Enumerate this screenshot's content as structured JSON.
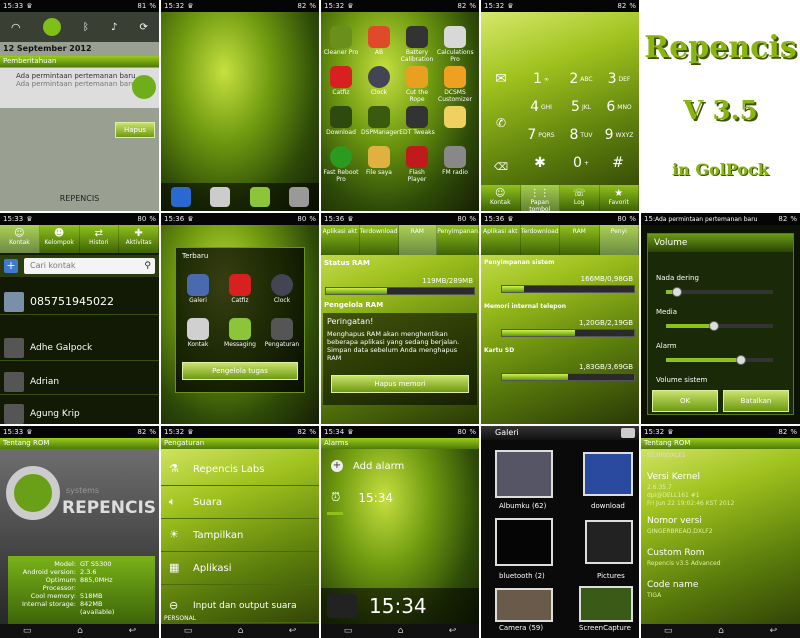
{
  "status": {
    "c1": "15:33",
    "c2": "15:32",
    "c3": "15:32",
    "c4": "15:32",
    "c6": "15:33",
    "c7": "15:36",
    "c8": "15:36",
    "c9": "15:36",
    "c10": "15:32",
    "c11": "15:33",
    "c12": "15:32",
    "c13": "15:34",
    "c14": "",
    "c15": "15:32",
    "batt_a": "81",
    "batt_b": "82",
    "batt_c": "80"
  },
  "notif": {
    "date": "12 September 2012",
    "header": "Pemberitahuan",
    "title": "Ada permintaan pertemanan baru",
    "sub": "Ada permintaan pertemanan baru",
    "button": "Hapus",
    "carrier": "REPENCIS"
  },
  "apps3": [
    [
      "Cleaner Pro",
      "AB",
      "Battery Calibration",
      "Calculations Pro"
    ],
    [
      "Catfiz",
      "Clock",
      "Cut the Rope",
      "DCSMS Customizer"
    ],
    [
      "Download",
      "DSPManager",
      "EDT Tweaks",
      ""
    ],
    [
      "Fast Reboot Pro",
      "File saya",
      "Flash Player",
      "FM radio"
    ]
  ],
  "dialer": {
    "keys": [
      [
        "1",
        "∞"
      ],
      [
        "2",
        "ABC"
      ],
      [
        "3",
        "DEF"
      ],
      [
        "4",
        "GHI"
      ],
      [
        "5",
        "JKL"
      ],
      [
        "6",
        "MNO"
      ],
      [
        "7",
        "PQRS"
      ],
      [
        "8",
        "TUV"
      ],
      [
        "9",
        "WXYZ"
      ],
      [
        "✱",
        ""
      ],
      [
        "0",
        "+"
      ],
      [
        "#",
        ""
      ]
    ],
    "tabs": [
      "Kontak",
      "Papan tombol",
      "Log",
      "Favorit"
    ]
  },
  "logo": {
    "l1": "Repencis",
    "l2": "V 3.5",
    "l3": "in GolPock"
  },
  "contacts": {
    "tabs": [
      "Kontak",
      "Kelompok",
      "Histori",
      "Aktivitas"
    ],
    "search": "Cari kontak",
    "rows": [
      "085751945022",
      "Adhe Galpock",
      "Adrian",
      "Agung Krip"
    ]
  },
  "recent": {
    "title": "Terbaru",
    "apps": [
      "Galeri",
      "Catfiz",
      "Clock",
      "Kontak",
      "Messaging",
      "Pengaturan"
    ],
    "button": "Pengelola tugas"
  },
  "ram": {
    "tabs": [
      "Aplikasi akt",
      "Terdownload",
      "RAM",
      "Penyimpanan"
    ],
    "status": "Status RAM",
    "usage": "119MB/289MB",
    "manager": "Pengelola RAM",
    "warn_title": "Peringatan!",
    "warn_text": "Menghapus RAM akan menghentikan beberapa aplikasi yang sedang berjalan. Simpan data sebelum Anda menghapus RAM",
    "button": "Hapus memori",
    "ram_fill": 0.41
  },
  "storage": {
    "tabs": [
      "Aplikasi akt",
      "Terdownload",
      "RAM",
      "Penyi"
    ],
    "sys": "Penyimpanan sistem",
    "sys_v": "166MB/0,98GB",
    "int": "Memori internal telepon",
    "int_v": "1,20GB/2,19GB",
    "sd": "Kartu SD",
    "sd_v": "1,83GB/3,69GB",
    "sys_fill": 0.17,
    "int_fill": 0.55,
    "sd_fill": 0.5
  },
  "volume": {
    "notif": "Ada permintaan pertemanan baru",
    "title": "Volume",
    "ring": "Nada dering",
    "media": "Media",
    "alarm": "Alarm",
    "system": "Volume sistem",
    "ok": "OK",
    "cancel": "Batalkan",
    "ring_v": 0.1,
    "media_v": 0.45,
    "alarm_v": 0.7
  },
  "about": {
    "header": "Tentang ROM",
    "brand": "REPENCIS",
    "systems": "systems",
    "specs": [
      [
        "Model:",
        "GT S5300"
      ],
      [
        "Android version:",
        "2.3.6"
      ],
      [
        "Optimum Processor:",
        "885,0MHz"
      ],
      [
        "Cool memory:",
        "518MB"
      ],
      [
        "Internal storage:",
        "842MB"
      ]
    ],
    "avail": "(available)"
  },
  "settings": {
    "header": "Pengaturan",
    "items": [
      "Repencis Labs",
      "Suara",
      "Tampilkan",
      "Aplikasi",
      "Input dan output suara"
    ],
    "footer": "PERSONAL"
  },
  "alarm": {
    "header": "Alarms",
    "add": "Add alarm",
    "time": "15:34",
    "clock": "15:34"
  },
  "gallery": {
    "title": "Galeri",
    "albums": [
      [
        "Albumku",
        "(62)"
      ],
      [
        "download",
        ""
      ],
      [
        "bluetooth",
        "(2)"
      ],
      [
        "Pictures",
        ""
      ],
      [
        "Camera",
        "(59)"
      ],
      [
        "ScreenCapture",
        ""
      ]
    ]
  },
  "kernel": {
    "header": "Tentang ROM",
    "build": "S5300DXLE1",
    "k_title": "Versi Kernel",
    "k_v": "2.6.35.7",
    "k_v2": "dpi@DELL161 #1",
    "k_v3": "Fri Jun 22 19:02:46 KST 2012",
    "n_title": "Nomor versi",
    "n_v": "GINGERBREAD.DXLF2",
    "c_title": "Custom Rom",
    "c_v": "Repencis v3.5 Advanced",
    "code_title": "Code name",
    "code_v": "TIGA"
  }
}
